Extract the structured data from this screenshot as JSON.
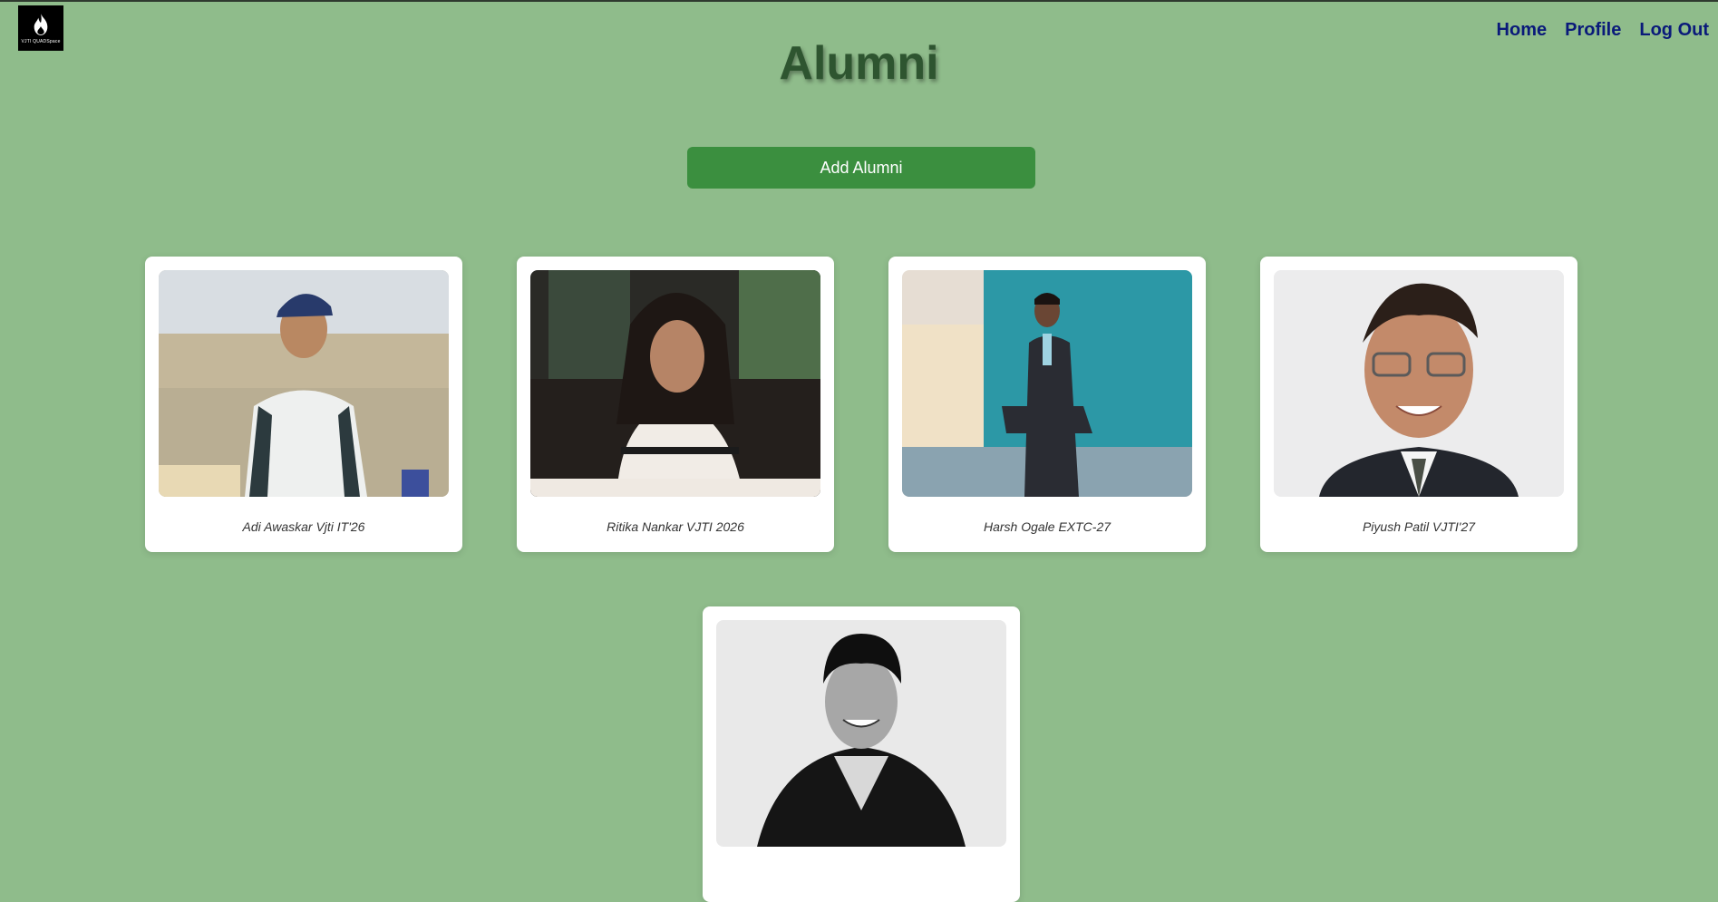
{
  "logo": {
    "icon": "flame-icon",
    "text": "VJTI QUADSpace"
  },
  "nav": {
    "home": "Home",
    "profile": "Profile",
    "logout": "Log Out"
  },
  "page": {
    "title": "Alumni",
    "add_button": "Add Alumni"
  },
  "alumni": [
    {
      "caption": "Adi Awaskar Vjti IT'26"
    },
    {
      "caption": "Ritika Nankar VJTI 2026"
    },
    {
      "caption": "Harsh Ogale EXTC-27"
    },
    {
      "caption": "Piyush Patil VJTI'27"
    },
    {
      "caption": ""
    }
  ],
  "colors": {
    "background": "#8fbc8b",
    "button": "#3b8f3f",
    "nav_link": "#0a1a7a",
    "title": "#2e5530"
  }
}
